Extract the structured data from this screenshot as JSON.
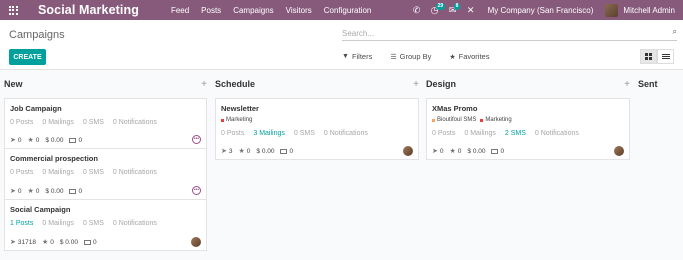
{
  "navbar": {
    "brand": "Social Marketing",
    "menu": [
      "Feed",
      "Posts",
      "Campaigns",
      "Visitors",
      "Configuration"
    ],
    "activity_badge": "29",
    "messages_badge": "8",
    "company": "My Company (San Francisco)",
    "user": "Mitchell Admin"
  },
  "control": {
    "breadcrumb": "Campaigns",
    "create_label": "CREATE",
    "search_placeholder": "Search...",
    "filters_label": "Filters",
    "groupby_label": "Group By",
    "favorites_label": "Favorites"
  },
  "columns": [
    {
      "name": "New",
      "cards": [
        {
          "title": "Job Campaign",
          "tags": [],
          "posts": "0 Posts",
          "mailings": "0 Mailings",
          "sms": "0 SMS",
          "notifications": "0 Notifications",
          "clicks": "0",
          "stars": "0",
          "revenue": "$ 0.00",
          "messages": "0"
        },
        {
          "title": "Commercial prospection",
          "tags": [],
          "posts": "0 Posts",
          "mailings": "0 Mailings",
          "sms": "0 SMS",
          "notifications": "0 Notifications",
          "clicks": "0",
          "stars": "0",
          "revenue": "$ 0.00",
          "messages": "0"
        },
        {
          "title": "Social Campaign",
          "tags": [],
          "posts": "1 Posts",
          "mailings": "0 Mailings",
          "sms": "0 SMS",
          "notifications": "0 Notifications",
          "clicks": "31718",
          "stars": "0",
          "revenue": "$ 0.00",
          "messages": "0"
        }
      ]
    },
    {
      "name": "Schedule",
      "cards": [
        {
          "title": "Newsletter",
          "tags": [
            "Marketing"
          ],
          "posts": "0 Posts",
          "mailings": "3 Mailings",
          "sms": "0 SMS",
          "notifications": "0 Notifications",
          "clicks": "3",
          "stars": "0",
          "revenue": "$ 0.00",
          "messages": "0"
        }
      ]
    },
    {
      "name": "Design",
      "cards": [
        {
          "title": "XMas Promo",
          "tags": [
            "Bioutifoul SMS",
            "Marketing"
          ],
          "posts": "0 Posts",
          "mailings": "0 Mailings",
          "sms": "2 SMS",
          "notifications": "0 Notifications",
          "clicks": "0",
          "stars": "0",
          "revenue": "$ 0.00",
          "messages": "0"
        }
      ]
    },
    {
      "name": "Sent",
      "cards": []
    }
  ],
  "colors": {
    "navbar": "#875a7b",
    "accent": "#00a09d",
    "tag_marketing": "#e8413c",
    "tag_sms": "#f4a460"
  }
}
